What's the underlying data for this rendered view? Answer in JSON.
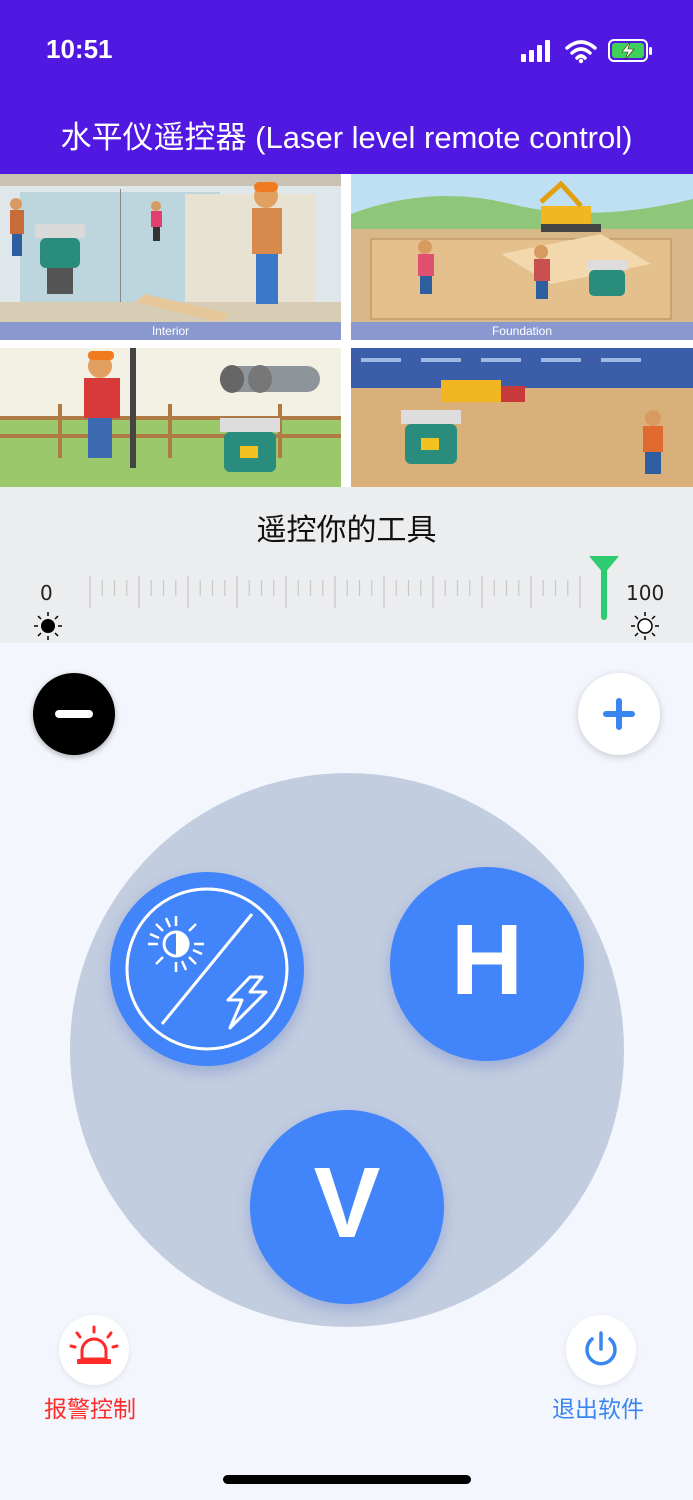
{
  "status_bar": {
    "time": "10:51",
    "icons": [
      "signal-icon",
      "wifi-icon",
      "battery-charging-icon"
    ]
  },
  "app_bar": {
    "title": "水平仪遥控器 (Laser level remote control)"
  },
  "banner": {
    "tiles": [
      {
        "caption": "Interior"
      },
      {
        "caption": "Foundation"
      },
      {
        "caption": ""
      },
      {
        "caption": ""
      }
    ]
  },
  "brightness": {
    "title": "遥控你的工具",
    "min_label": "0",
    "max_label": "100",
    "value": 100,
    "thumb_color": "#2ecc71"
  },
  "controls": {
    "minus_icon": "minus-icon",
    "plus_icon": "plus-icon",
    "mode_buttons": [
      {
        "name": "sun-lightning-icon"
      },
      {
        "letter": "H"
      },
      {
        "letter": "V"
      }
    ]
  },
  "bottom_actions": {
    "alarm_label": "报警控制",
    "exit_label": "退出软件"
  },
  "colors": {
    "header": "#5018e0",
    "accent": "#4285fb",
    "alarm": "#ff2a2a",
    "exit": "#3a86f0"
  }
}
